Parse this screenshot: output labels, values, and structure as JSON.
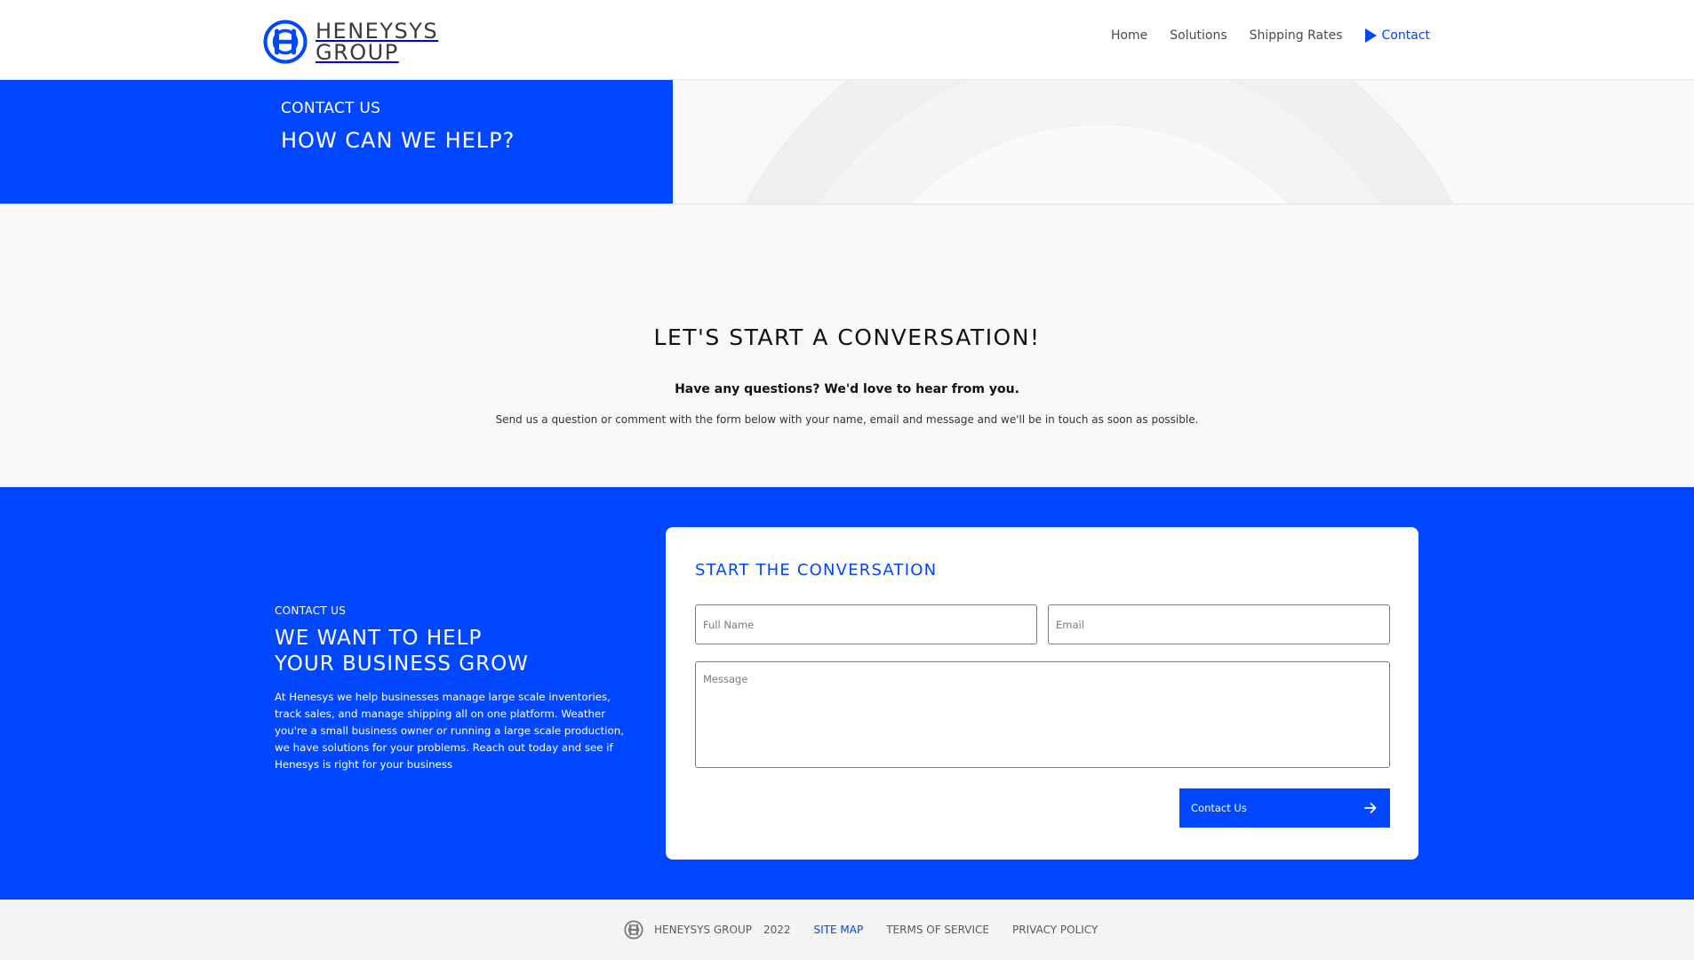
{
  "colors": {
    "brand_blue": "#0047ff",
    "nav_text": "#4a4a4a",
    "page_bg": "#f8f8f8",
    "card_bg": "#ffffff"
  },
  "header": {
    "logo": {
      "icon": "h-circle-logo-icon",
      "line1": "HENEYSYS",
      "line2": "GROUP"
    },
    "nav": {
      "home": "Home",
      "solutions": "Solutions",
      "shipping_rates": "Shipping Rates",
      "contact": "Contact",
      "active_icon": "play-icon"
    }
  },
  "hero": {
    "eyebrow": "CONTACT US",
    "title": "HOW CAN WE HELP?"
  },
  "intro": {
    "title": "LET'S START A CONVERSATION!",
    "subtitle": "Have any questions? We'd love to hear from you.",
    "description": "Send us a question or comment with the form below with your name, email and message and we'll be in touch as soon as possible."
  },
  "contact": {
    "eyebrow": "CONTACT US",
    "title_line1": "WE WANT TO HELP",
    "title_line2": "YOUR BUSINESS GROW",
    "body": "At Henesys we help businesses manage large scale inventories, track sales, and manage shipping all on one platform. Weather you're a small business owner or running a large scale production, we have solutions for your problems. Reach out today and see if Henesys is right for your business",
    "form": {
      "title": "START THE CONVERSATION",
      "full_name_placeholder": "Full Name",
      "email_placeholder": "Email",
      "message_placeholder": "Message",
      "submit_label": "Contact Us",
      "submit_icon": "arrow-right-icon"
    }
  },
  "footer": {
    "logo_icon": "h-circle-logo-icon",
    "brand": "HENEYSYS GROUP",
    "year": "2022",
    "links": {
      "site_map": "SITE MAP",
      "terms": "TERMS OF SERVICE",
      "privacy": "PRIVACY POLICY"
    }
  }
}
